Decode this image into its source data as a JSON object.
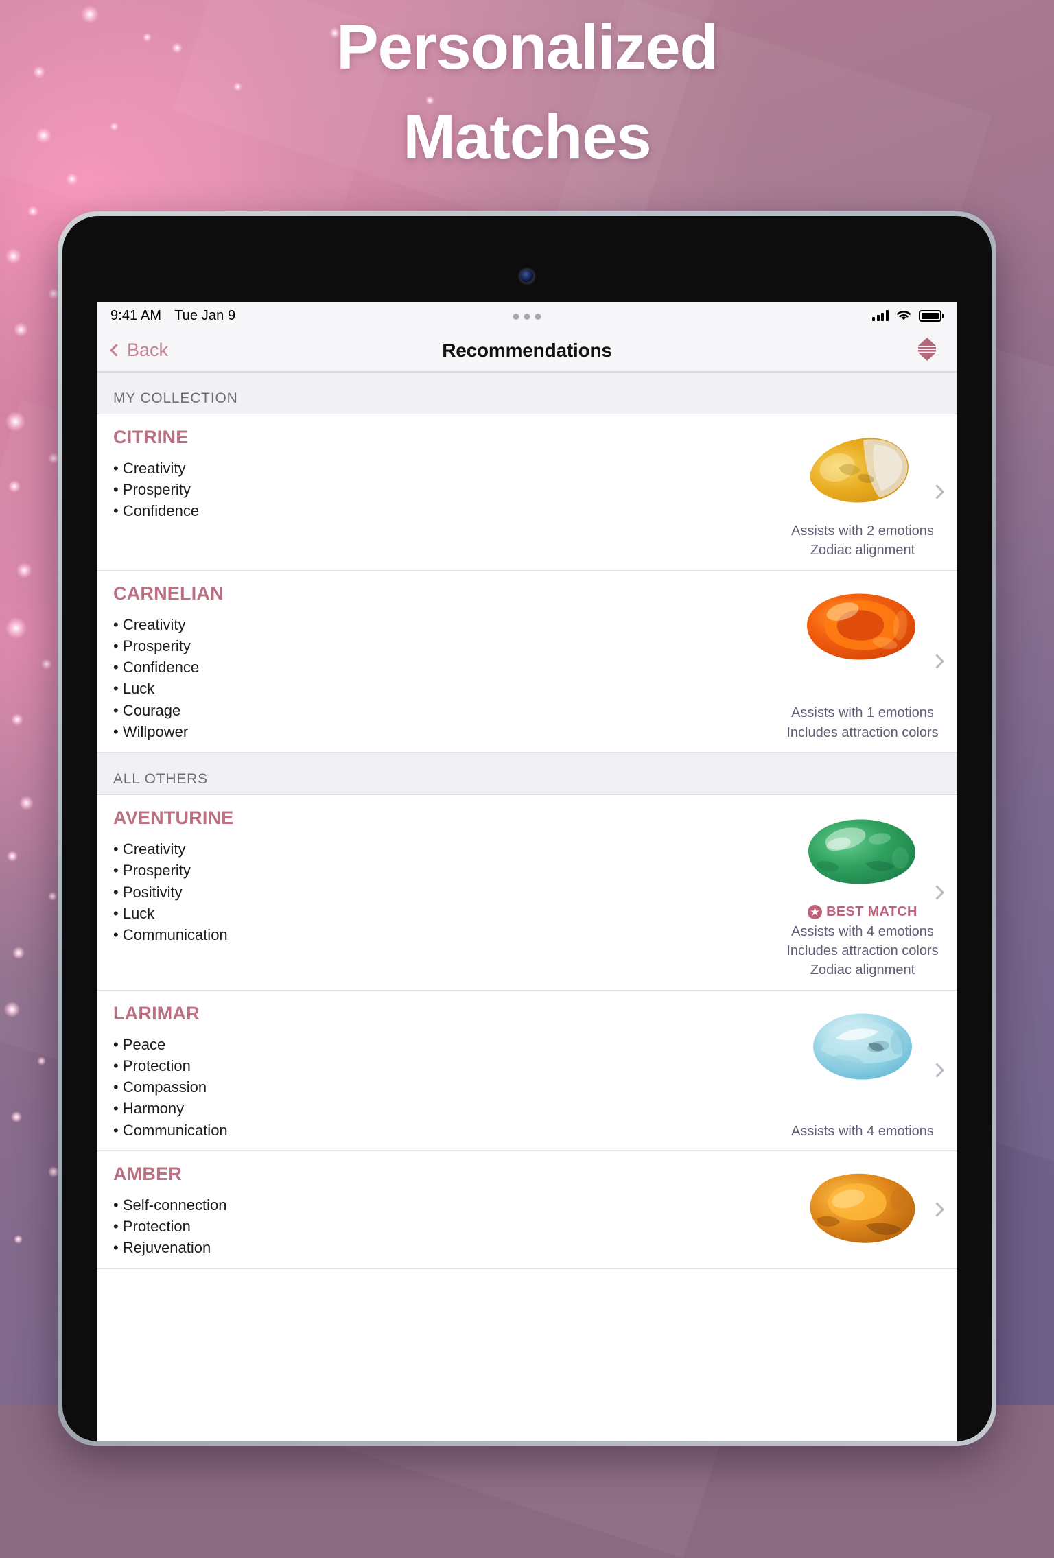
{
  "headline": "Personalized\nMatches",
  "colors": {
    "accent": "#bb7082",
    "badge": "#c0637a",
    "back_link": "#c37f8e",
    "section_bg": "#f1f1f5",
    "subtext": "#5f6075"
  },
  "status_bar": {
    "time": "9:41 AM",
    "date": "Tue Jan 9",
    "signal_icon": "cellular-signal-icon",
    "wifi_icon": "wifi-icon",
    "battery_icon": "battery-icon"
  },
  "nav": {
    "back_label": "Back",
    "back_icon": "chevron-left-icon",
    "title": "Recommendations",
    "sort_icon": "sort-ascending-descending-icon"
  },
  "sections": [
    {
      "header": "MY COLLECTION",
      "rows": [
        {
          "name": "CITRINE",
          "traits": [
            "Creativity",
            "Prosperity",
            "Confidence"
          ],
          "best_match": false,
          "badges": [
            "Assists with 2 emotions",
            "Zodiac alignment"
          ],
          "image": "citrine-stone-image",
          "disclosure_icon": "chevron-right-icon"
        },
        {
          "name": "CARNELIAN",
          "traits": [
            "Creativity",
            "Prosperity",
            "Confidence",
            "Luck",
            "Courage",
            "Willpower"
          ],
          "best_match": false,
          "badges": [
            "Assists with 1 emotions",
            "Includes attraction colors"
          ],
          "image": "carnelian-stone-image",
          "disclosure_icon": "chevron-right-icon"
        }
      ]
    },
    {
      "header": "ALL OTHERS",
      "rows": [
        {
          "name": "AVENTURINE",
          "traits": [
            "Creativity",
            "Prosperity",
            "Positivity",
            "Luck",
            "Communication"
          ],
          "best_match": true,
          "best_match_label": "BEST MATCH",
          "best_match_icon": "star-badge-icon",
          "badges": [
            "Assists with 4 emotions",
            "Includes attraction colors",
            "Zodiac alignment"
          ],
          "image": "aventurine-stone-image",
          "disclosure_icon": "chevron-right-icon"
        },
        {
          "name": "LARIMAR",
          "traits": [
            "Peace",
            "Protection",
            "Compassion",
            "Harmony",
            "Communication"
          ],
          "best_match": false,
          "badges": [
            "Assists with 4 emotions"
          ],
          "image": "larimar-stone-image",
          "disclosure_icon": "chevron-right-icon"
        },
        {
          "name": "AMBER",
          "traits": [
            "Self-connection",
            "Protection",
            "Rejuvenation"
          ],
          "best_match": false,
          "badges": [],
          "image": "amber-stone-image",
          "disclosure_icon": "chevron-right-icon"
        }
      ]
    }
  ]
}
